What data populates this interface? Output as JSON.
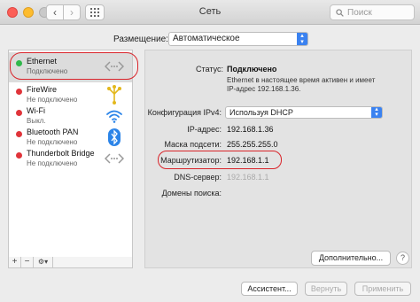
{
  "window": {
    "title": "Сеть",
    "search_placeholder": "Поиск"
  },
  "location": {
    "label": "Размещение:",
    "value": "Автоматическое"
  },
  "services": [
    {
      "name": "Ethernet",
      "status": "Подключено",
      "status_color": "#2fb84b",
      "icon": "ethernet-arrows-icon",
      "selected": true
    },
    {
      "name": "FireWire",
      "status": "Не подключено",
      "status_color": "#e0343a",
      "icon": "firewire-icon"
    },
    {
      "name": "Wi-Fi",
      "status": "Выкл.",
      "status_color": "#e0343a",
      "icon": "wifi-icon"
    },
    {
      "name": "Bluetooth PAN",
      "status": "Не подключено",
      "status_color": "#e0343a",
      "icon": "bluetooth-icon"
    },
    {
      "name": "Thunderbolt Bridge",
      "status": "Не подключено",
      "status_color": "#e0343a",
      "icon": "ethernet-arrows-icon"
    }
  ],
  "sidebar_toolbar": {
    "add": "+",
    "remove": "−",
    "gear": "⚙▾"
  },
  "detail": {
    "status_label": "Статус:",
    "status_value": "Подключено",
    "status_desc_line1": "Ethernet в настоящее время активен и имеет",
    "status_desc_line2": "IP-адрес 192.168.1.36.",
    "ipv4_label": "Конфигурация IPv4:",
    "ipv4_value": "Используя DHCP",
    "ip_label": "IP-адрес:",
    "ip_value": "192.168.1.36",
    "mask_label": "Маска подсети:",
    "mask_value": "255.255.255.0",
    "router_label": "Маршрутизатор:",
    "router_value": "192.168.1.1",
    "dns_label": "DNS-сервер:",
    "dns_value": "192.168.1.1",
    "domains_label": "Домены поиска:",
    "advanced_button": "Дополнительно...",
    "help_button": "?"
  },
  "footer": {
    "assistant": "Ассистент...",
    "revert": "Вернуть",
    "apply": "Применить"
  },
  "colors": {
    "highlight_circle": "#d9242a",
    "accent": "#3b82f0"
  }
}
